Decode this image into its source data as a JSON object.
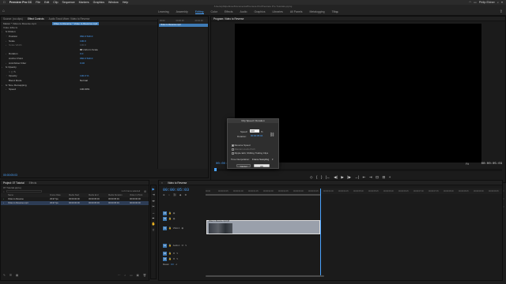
{
  "mac_menu": {
    "app": "Premiere Pro CC",
    "items": [
      "File",
      "Edit",
      "Clip",
      "Sequence",
      "Markers",
      "Graphics",
      "Window",
      "Help"
    ],
    "user": "Philip Ebiner"
  },
  "path": "/Users/philipebiner/Documents/Premiere Pro/Premiere Pro Tutorials.prproj",
  "workspace": {
    "tabs": [
      "Learning",
      "Assembly",
      "Editing",
      "Color",
      "Effects",
      "Audio",
      "Graphics",
      "Libraries",
      "All Panels",
      "Metalogging",
      "Titles"
    ],
    "active": "Editing"
  },
  "effect_controls": {
    "tabs": [
      "Source: (no clips)",
      "Effect Controls",
      "Audio Track Mixer: Video to Reverse",
      "Lumetri Scopes"
    ],
    "active": "Effect Controls",
    "subhead_source": "Master * Video to Reverse.mp4",
    "subhead_seq": "Video to Reverse * Video to Reverse.mp4",
    "header": "Video Effects",
    "rows": [
      {
        "name": "fx  Motion",
        "value": ""
      },
      {
        "name": "Position",
        "value": "960.0   540.0"
      },
      {
        "name": "Scale",
        "value": "100.0"
      },
      {
        "name": "Scale Width",
        "value": "100.0"
      },
      {
        "name": "",
        "value": "Uniform Scale"
      },
      {
        "name": "Rotation",
        "value": "0.0"
      },
      {
        "name": "Anchor Point",
        "value": "960.0   540.0"
      },
      {
        "name": "Anti-flicker Filter",
        "value": "0.00"
      },
      {
        "name": "fx  Opacity",
        "value": ""
      },
      {
        "name": "Opacity",
        "value": "100.0 %"
      },
      {
        "name": "Blend Mode",
        "value": "Normal"
      },
      {
        "name": "fx  Time Remapping",
        "value": ""
      },
      {
        "name": "Speed",
        "value": "100.00%"
      }
    ],
    "mini_timeline": {
      "ticks": [
        "00:00",
        "00:00:15",
        "00:00:30"
      ],
      "clip": "Video to Reverse.mp4"
    },
    "bottom_tc": "00:00:05:03"
  },
  "program": {
    "title": "Program: Video to Reverse",
    "tc_left": "00:00:05:03",
    "fit": "Fit",
    "tc_right": "00:00:05:03",
    "controls": [
      "◇",
      "{",
      "}",
      "|←",
      "◀|",
      "▶",
      "|▶",
      "→|",
      "⇤",
      "⇥",
      "⊡",
      "⊟",
      "+"
    ]
  },
  "dialog": {
    "title": "Clip Speed / Duration",
    "speed_label": "Speed:",
    "speed_value": "100",
    "speed_unit": "%",
    "duration_label": "Duration:",
    "duration_value": "00:00:05:04",
    "reverse": "Reverse Speed",
    "maintain": "Maintain Audio Pitch",
    "ripple": "Ripple Edit, Shifting Trailing Clips",
    "interp_label": "Time Interpolation:",
    "interp_value": "Frame Sampling",
    "cancel": "Cancel",
    "ok": "OK"
  },
  "project": {
    "tabs": [
      "Project: 07 Tutorial",
      "Effects"
    ],
    "head2": "07 Tutorial.prproj",
    "search_placeholder": "",
    "item_count": "1 of 2 items selected",
    "columns": [
      "Name",
      "Frame Rate",
      "Media Start",
      "Media End",
      "Media Duration",
      "Video In Point"
    ],
    "rows": [
      [
        "Video to Reverse",
        "29.97 fps",
        "00:00:00:00",
        "00:00:05:03",
        "00:00:05:04",
        "00:00:00:00"
      ],
      [
        "Video to Reverse.mp4",
        "29.97 fps",
        "00:00:00:00",
        "00:00:05:03",
        "00:00:05:04",
        "00:00:00:00"
      ]
    ]
  },
  "sequence": {
    "tab": "Video to Reverse",
    "timecode": "00:00:05:03",
    "ruler": [
      "00:00",
      "00:00:00:15",
      "00:00:01:00",
      "00:00:01:15",
      "00:00:02:00",
      "00:00:02:15",
      "00:00:03:00",
      "00:00:03:15",
      "00:00:04:00",
      "00:00:04:15",
      "00:00:05:00",
      "00:00:05:15",
      "00:00:06:00",
      "00:00:06:15",
      "00:00:07:00",
      "00:00:07:15",
      "00:00:08:00",
      "00:00:08:15",
      "00:00:09:00",
      "00:00:09:15"
    ],
    "tracks": [
      "V3",
      "V2",
      "V1",
      "A1",
      "A2",
      "A3",
      "Master"
    ],
    "track_v1_name": "Video 1",
    "track_a1_name": "Audio 1",
    "master_value": "0.0",
    "clip_name": "Video to Reverse.mp4 [V]"
  }
}
